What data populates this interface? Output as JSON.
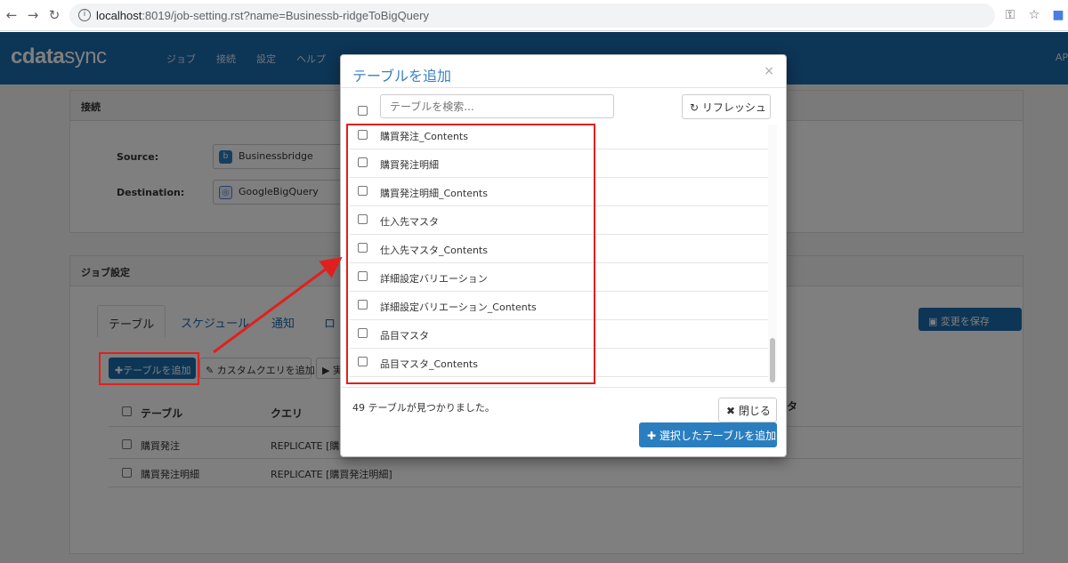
{
  "browser": {
    "url_host": "localhost",
    "url_path": ":8019/job-setting.rst?name=Businessb-ridgeToBigQuery"
  },
  "app": {
    "logo_left": "cdata",
    "logo_right": "sync",
    "nav": [
      "ジョブ",
      "接続",
      "設定",
      "ヘルプ"
    ],
    "top_right": "AP"
  },
  "connection_panel": {
    "title": "接続",
    "source_label": "Source:",
    "source_value": "Businessbridge",
    "destination_label": "Destination:",
    "destination_value": "GoogleBigQuery"
  },
  "job_panel": {
    "title": "ジョブ設定",
    "tabs": [
      "テーブル",
      "スケジュール",
      "通知",
      "ロ"
    ],
    "save_label": "変更を保存",
    "add_table_label": "テーブルを追加",
    "custom_query_label": "カスタムクエリを追加",
    "run_label": "実",
    "col_table": "テーブル",
    "col_query": "クエリ",
    "col_tail": "タ",
    "rows": [
      {
        "table": "購買発注",
        "query": "REPLICATE [購買"
      },
      {
        "table": "購買発注明細",
        "query": "REPLICATE [購買発注明細]"
      }
    ]
  },
  "modal": {
    "title": "テーブルを追加",
    "close_glyph": "×",
    "search_placeholder": "テーブルを検索...",
    "refresh_label": "リフレッシュ",
    "items": [
      "購買発注_Contents",
      "購買発注明細",
      "購買発注明細_Contents",
      "仕入先マスタ",
      "仕入先マスタ_Contents",
      "詳細設定バリエーション",
      "詳細設定バリエーション_Contents",
      "品目マスタ",
      "品目マスタ_Contents"
    ],
    "found_text": "49 テーブルが見つかりました。",
    "close_label": "閉じる",
    "add_selected_label": "選択したテーブルを追加"
  },
  "colors": {
    "header_blue": "#1b6aad",
    "primary": "#2a7ec0",
    "annotation_red": "#e0201e"
  }
}
